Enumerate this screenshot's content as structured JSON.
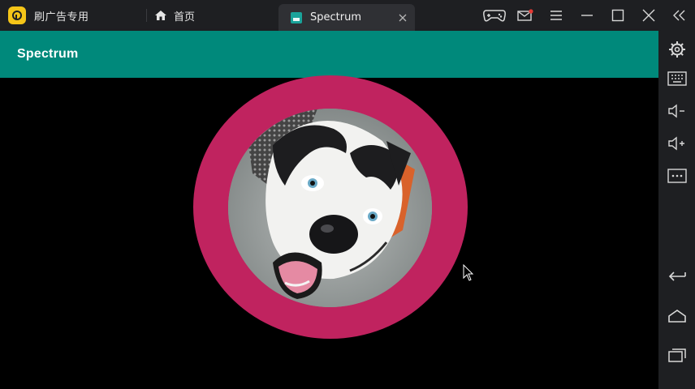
{
  "emulator": {
    "brand_text": "刷广告专用",
    "home_label": "首页",
    "tab_title": "Spectrum",
    "colors": {
      "chrome": "#1e1f22",
      "tab": "#2f3034",
      "brand": "#f5c518"
    },
    "top_icons": [
      "gamepad-icon",
      "mail-icon",
      "menu-icon",
      "minimize-icon",
      "maximize-icon",
      "close-icon",
      "collapse-sidebar-icon"
    ],
    "sidebar_icons": [
      "settings-icon",
      "keyboard-icon",
      "volume-down-icon",
      "volume-up-icon",
      "more-icon",
      "back-icon",
      "home-icon",
      "recents-icon"
    ]
  },
  "app": {
    "title": "Spectrum",
    "colors": {
      "app_bar": "#00897b",
      "ring": "#c0235f",
      "background": "#000000"
    },
    "image_description_icon": "husky-photo"
  }
}
